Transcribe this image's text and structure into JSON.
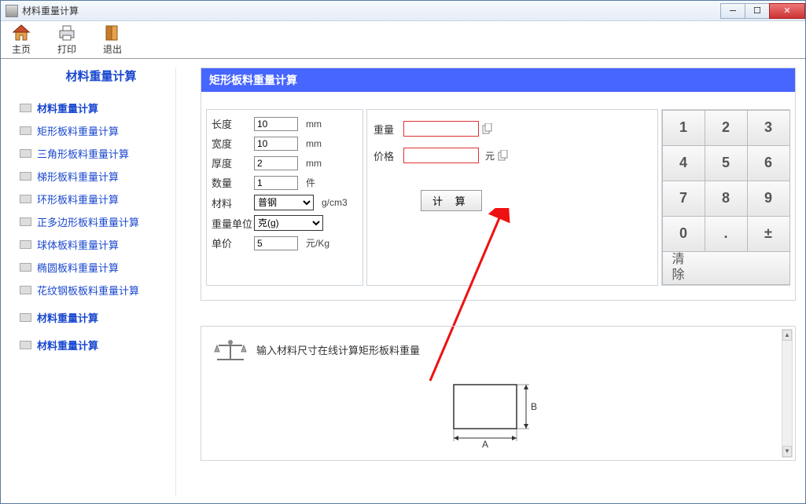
{
  "window": {
    "title": "材料重量计算"
  },
  "toolbar": {
    "home": "主页",
    "print": "打印",
    "exit": "退出"
  },
  "sidebar": {
    "title": "材料重量计算",
    "items": [
      {
        "label": "材料重量计算",
        "bold": true
      },
      {
        "label": "矩形板料重量计算"
      },
      {
        "label": "三角形板料重量计算"
      },
      {
        "label": "梯形板料重量计算"
      },
      {
        "label": "环形板料重量计算"
      },
      {
        "label": "正多边形板料重量计算"
      },
      {
        "label": "球体板料重量计算"
      },
      {
        "label": "椭圆板料重量计算"
      },
      {
        "label": "花纹钢板板料重量计算"
      },
      {
        "label": "材料重量计算",
        "bold": true
      },
      {
        "label": "材料重量计算",
        "bold": true
      }
    ]
  },
  "panel": {
    "title": "矩形板料重量计算",
    "form": {
      "length_label": "长度",
      "length_value": "10",
      "length_unit": "mm",
      "width_label": "宽度",
      "width_value": "10",
      "width_unit": "mm",
      "thick_label": "厚度",
      "thick_value": "2",
      "thick_unit": "mm",
      "qty_label": "数量",
      "qty_value": "1",
      "qty_unit": "件",
      "material_label": "材料",
      "material_value": "普钢",
      "material_unit": "g/cm3",
      "wunit_label": "重量单位",
      "wunit_value": "克(g)",
      "price_label": "单价",
      "price_value": "5",
      "price_unit": "元/Kg"
    },
    "result": {
      "weight_label": "重量",
      "price_label": "价格",
      "price_unit": "元",
      "calc_button": "计 算"
    },
    "keypad": [
      "1",
      "2",
      "3",
      "4",
      "5",
      "6",
      "7",
      "8",
      "9",
      "0",
      ".",
      "±"
    ],
    "clear_label": "清\n除"
  },
  "info": {
    "text": "输入材料尺寸在线计算矩形板料重量",
    "dim_a": "A",
    "dim_b": "B"
  }
}
